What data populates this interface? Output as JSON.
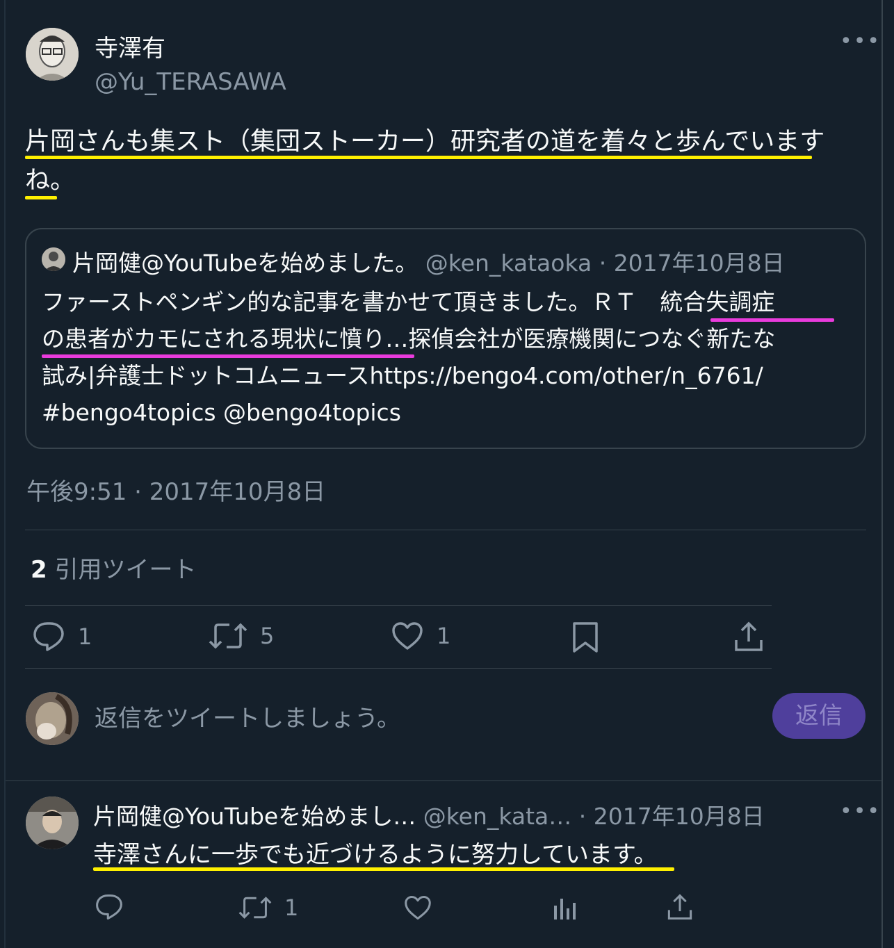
{
  "main_tweet": {
    "author_name": "寺澤有",
    "author_handle": "@Yu_TERASAWA",
    "text_line1": "片岡さんも集スト（集団ストーカー）研究者の道を着々と歩んでいます",
    "text_line2": "ね。",
    "timestamp": "午後9:51 · 2017年10月8日",
    "more_icon": "more-icon"
  },
  "quoted_tweet": {
    "author_name": "片岡健@YouTubeを始めました。",
    "author_handle": "@ken_kataoka",
    "date": " · 2017年10月8日",
    "line1": "ファーストペンギン的な記事を書かせて頂きました。ＲＴ　統合失調症",
    "line2": "の患者がカモにされる現状に憤り…探偵会社が医療機関につなぐ新たな",
    "line3": "試み|弁護士ドットコムニュースhttps://bengo4.com/other/n_6761/",
    "line4": "#bengo4topics @bengo4topics"
  },
  "quote_count": {
    "number": "2",
    "label": "引用ツイート"
  },
  "actions": {
    "reply_count": "1",
    "retweet_count": "5",
    "like_count": "1"
  },
  "reply_box": {
    "placeholder": "返信をツイートしましょう。",
    "button_label": "返信"
  },
  "reply_tweet": {
    "author_name": "片岡健@YouTubeを始めまし…",
    "author_handle": "@ken_kata…",
    "date": " · 2017年10月8日",
    "text": "寺澤さんに一歩でも近づけるように努力しています。",
    "retweet_count": "1"
  },
  "colors": {
    "background": "#15202b",
    "highlight_yellow": "#fff000",
    "highlight_pink": "#e93bdc",
    "reply_button": "#4f3f9c"
  }
}
